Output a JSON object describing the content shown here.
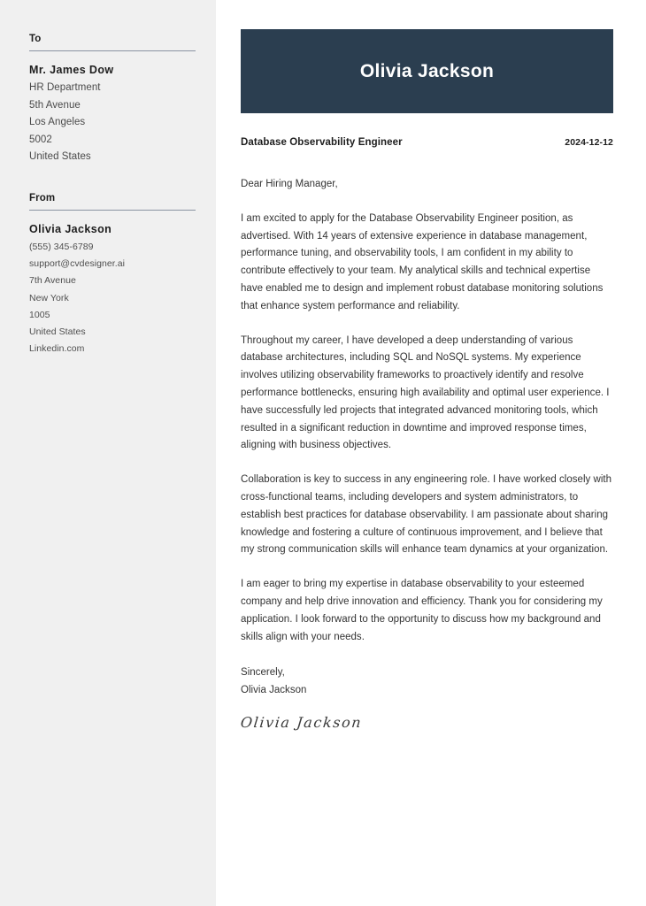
{
  "sidebar": {
    "to": {
      "heading": "To",
      "name": "Mr. James Dow",
      "lines": [
        "HR Department",
        "5th Avenue",
        "Los Angeles",
        "5002",
        "United States"
      ]
    },
    "from": {
      "heading": "From",
      "name": "Olivia Jackson",
      "lines": [
        "(555) 345-6789",
        "support@cvdesigner.ai",
        "7th Avenue",
        "New York",
        "1005",
        "United States",
        "Linkedin.com"
      ]
    }
  },
  "header": {
    "name": "Olivia Jackson",
    "banner_color": "#2b3e50"
  },
  "meta": {
    "job_title": "Database Observability Engineer",
    "date": "2024-12-12"
  },
  "letter": {
    "salutation": "Dear Hiring Manager,",
    "paragraphs": [
      "I am excited to apply for the Database Observability Engineer position, as advertised. With 14 years of extensive experience in database management, performance tuning, and observability tools, I am confident in my ability to contribute effectively to your team. My analytical skills and technical expertise have enabled me to design and implement robust database monitoring solutions that enhance system performance and reliability.",
      "Throughout my career, I have developed a deep understanding of various database architectures, including SQL and NoSQL systems. My experience involves utilizing observability frameworks to proactively identify and resolve performance bottlenecks, ensuring high availability and optimal user experience. I have successfully led projects that integrated advanced monitoring tools, which resulted in a significant reduction in downtime and improved response times, aligning with business objectives.",
      "Collaboration is key to success in any engineering role. I have worked closely with cross-functional teams, including developers and system administrators, to establish best practices for database observability. I am passionate about sharing knowledge and fostering a culture of continuous improvement, and I believe that my strong communication skills will enhance team dynamics at your organization.",
      "I am eager to bring my expertise in database observability to your esteemed company and help drive innovation and efficiency. Thank you for considering my application. I look forward to the opportunity to discuss how my background and skills align with your needs."
    ],
    "closing_word": "Sincerely,",
    "closing_name": "Olivia Jackson",
    "signature": "Olivia Jackson"
  }
}
